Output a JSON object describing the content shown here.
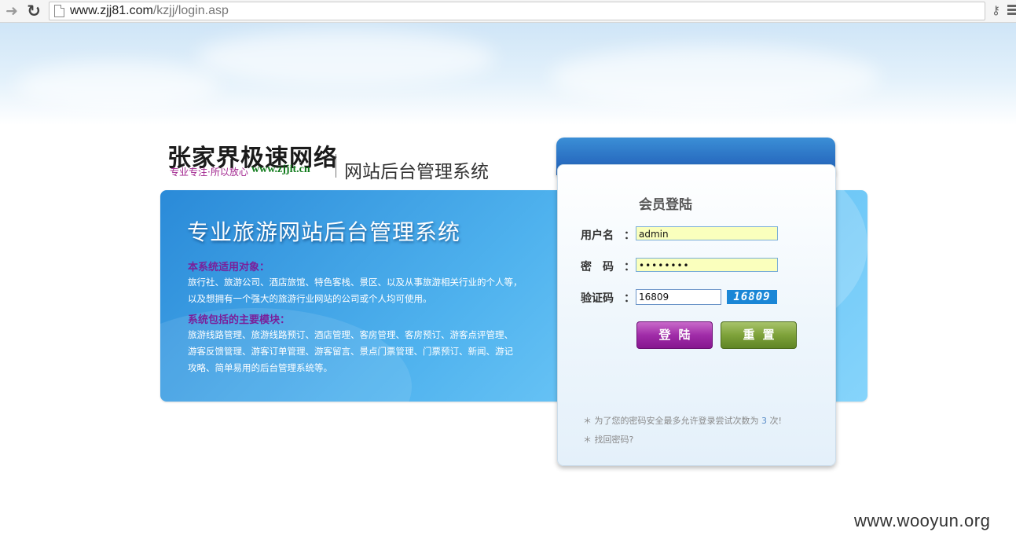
{
  "browser": {
    "url_host": "www.zjj81.com",
    "url_path": "/kzjj/login.asp"
  },
  "logo": {
    "name": "张家界极速网络",
    "slogan": "专业专注·所以放心",
    "site": "www.zjjit.cn",
    "system_title": "网站后台管理系统"
  },
  "banner": {
    "title": "专业旅游网站后台管理系统",
    "section1_title": "本系统适用对象：",
    "section1_line1": "旅行社、旅游公司、酒店旅馆、特色客栈、景区、以及从事旅游相关行业的个人等，",
    "section1_line2": "以及想拥有一个强大的旅游行业网站的公司或个人均可使用。",
    "section2_title": "系统包括的主要模块：",
    "section2_line1": "旅游线路管理、旅游线路预订、酒店管理、客房管理、客房预订、游客点评管理、",
    "section2_line2": "游客反馈管理、游客订单管理、游客留言、景点门票管理、门票预订、新闻、游记",
    "section2_line3": "攻略、简单易用的后台管理系统等。"
  },
  "login": {
    "title": "会员登陆",
    "username_label": "用户名",
    "password_label": "密　码",
    "captcha_label": "验证码",
    "colon": "：",
    "username_value": "admin",
    "password_value": "••••••••",
    "captcha_value": "16809",
    "captcha_image_text": "16809",
    "login_button": "登陆",
    "reset_button": "重置",
    "note1_prefix": "＊ 为了您的密码安全最多允许登录尝试次数为",
    "note1_count": "3",
    "note1_suffix": "次!",
    "note2": "＊ 找回密码?"
  },
  "watermark": "www.wooyun.org",
  "colors": {
    "banner_blue": "#4fb2ee",
    "login_button": "#a02ca8",
    "reset_button": "#7ea23a",
    "section_title": "#7a1f9a"
  }
}
